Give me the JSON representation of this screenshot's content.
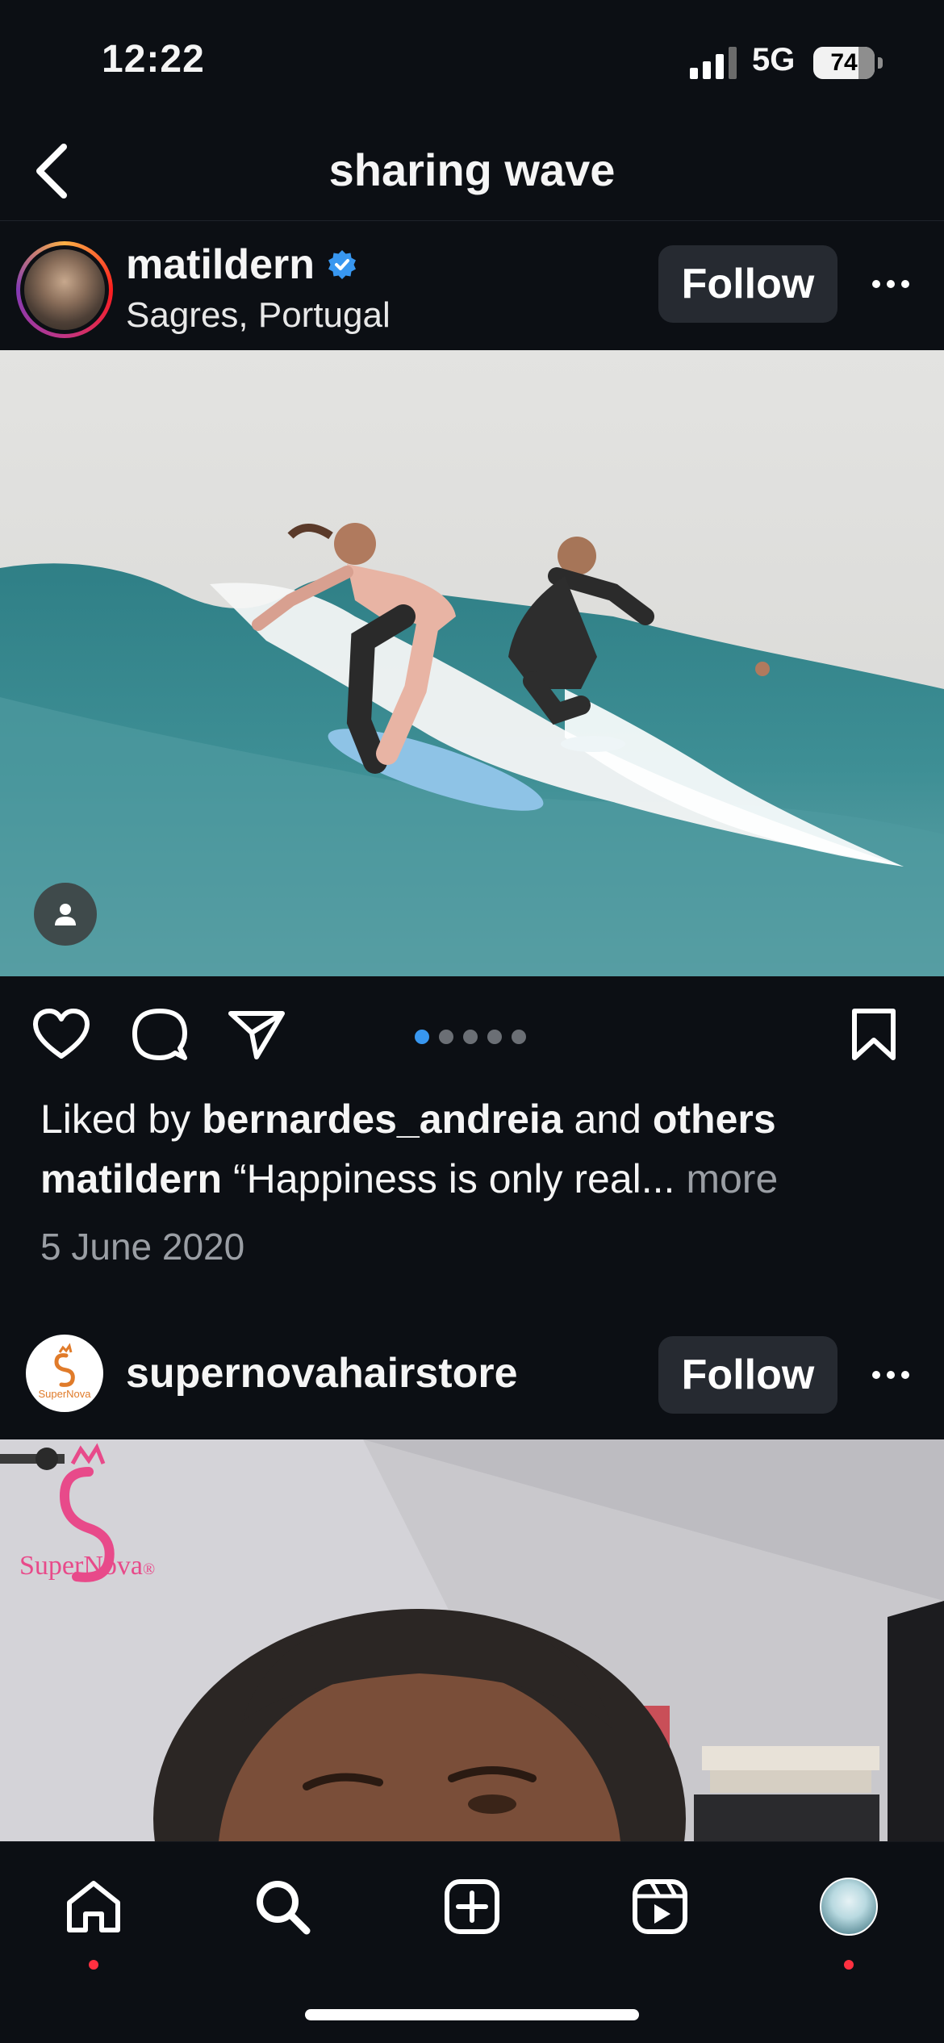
{
  "status_bar": {
    "time": "12:22",
    "network": "5G",
    "battery": "74",
    "battery_level": 0.74
  },
  "header": {
    "title": "sharing wave",
    "back_icon": "chevron-left-icon"
  },
  "post1": {
    "username": "matildern",
    "verified": true,
    "location": "Sagres, Portugal",
    "follow_label": "Follow",
    "carousel_total": 5,
    "carousel_active": 1,
    "likes_prefix": "Liked by",
    "likes_user": "bernardes_andreia",
    "likes_and": "and",
    "likes_others": "others",
    "caption_user": "matildern",
    "caption_text": "“Happiness is only real...",
    "caption_more": "more",
    "date": "5 June 2020"
  },
  "post2": {
    "username": "supernovahairstore",
    "follow_label": "Follow",
    "logo_text": "SuperNova",
    "logo_trademark": "®"
  },
  "tab_bar": {
    "items": [
      "home-icon",
      "search-icon",
      "create-icon",
      "reels-icon",
      "profile-icon"
    ]
  },
  "colors": {
    "background": "#0c0f14",
    "button": "#262a31",
    "accent_blue": "#3897f0",
    "notification": "#ff3040"
  }
}
